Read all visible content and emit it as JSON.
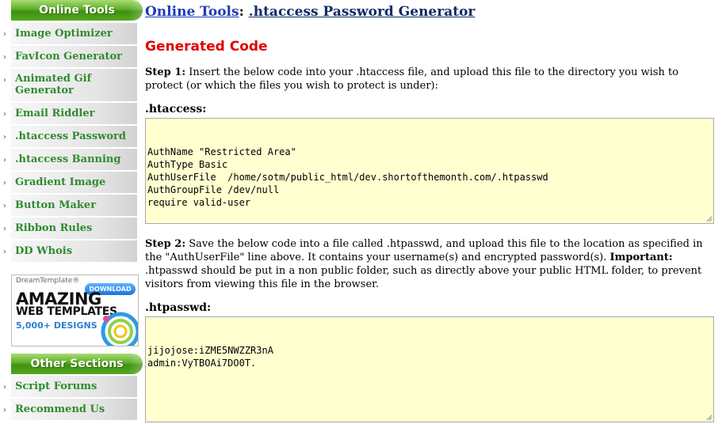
{
  "sidebar": {
    "tools_header": "Online Tools",
    "items": [
      {
        "label": "Image Optimizer"
      },
      {
        "label": "FavIcon Generator"
      },
      {
        "label": "Animated Gif Generator"
      },
      {
        "label": "Email Riddler"
      },
      {
        "label": ".htaccess Password"
      },
      {
        "label": ".htaccess Banning"
      },
      {
        "label": "Gradient Image"
      },
      {
        "label": "Button Maker"
      },
      {
        "label": "Ribbon Rules"
      },
      {
        "label": "DD Whois"
      }
    ],
    "ad": {
      "brand": "DreamTemplate®",
      "download": "DOWNLOAD",
      "line1": "AMAZING",
      "line2": "WEB TEMPLATES",
      "line3": "5,000+ DESIGNS"
    },
    "other_header": "Other Sections",
    "other_items": [
      {
        "label": "Script Forums"
      },
      {
        "label": "Recommend Us"
      }
    ]
  },
  "main": {
    "breadcrumb_root": "Online Tools",
    "breadcrumb_sep": ":",
    "breadcrumb_current": ".htaccess Password Generator",
    "section_title": "Generated Code",
    "step1_label": "Step 1:",
    "step1_text": " Insert the below code into your .htaccess file, and upload this file to the directory you wish to protect (or which the files you wish to protect is under):",
    "htaccess_label": ".htaccess:",
    "htaccess_code": "AuthName \"Restricted Area\"\nAuthType Basic\nAuthUserFile  /home/sotm/public_html/dev.shortofthemonth.com/.htpasswd\nAuthGroupFile /dev/null\nrequire valid-user",
    "step2_label": "Step 2:",
    "step2_text_a": " Save the below code into a file called .htpasswd, and upload this file to the location as specified in the \"AuthUserFile\" line above. It contains your username(s) and encrypted password(s). ",
    "step2_important": "Important:",
    "step2_text_b": " .htpasswd should be put in a non public folder, such as directly above your public HTML folder, to prevent visitors from viewing this file in the browser.",
    "htpasswd_label": ".htpasswd:",
    "htpasswd_code": "jijojose:iZME5NWZZR3nA\nadmin:VyTBOAi7DO0T."
  }
}
